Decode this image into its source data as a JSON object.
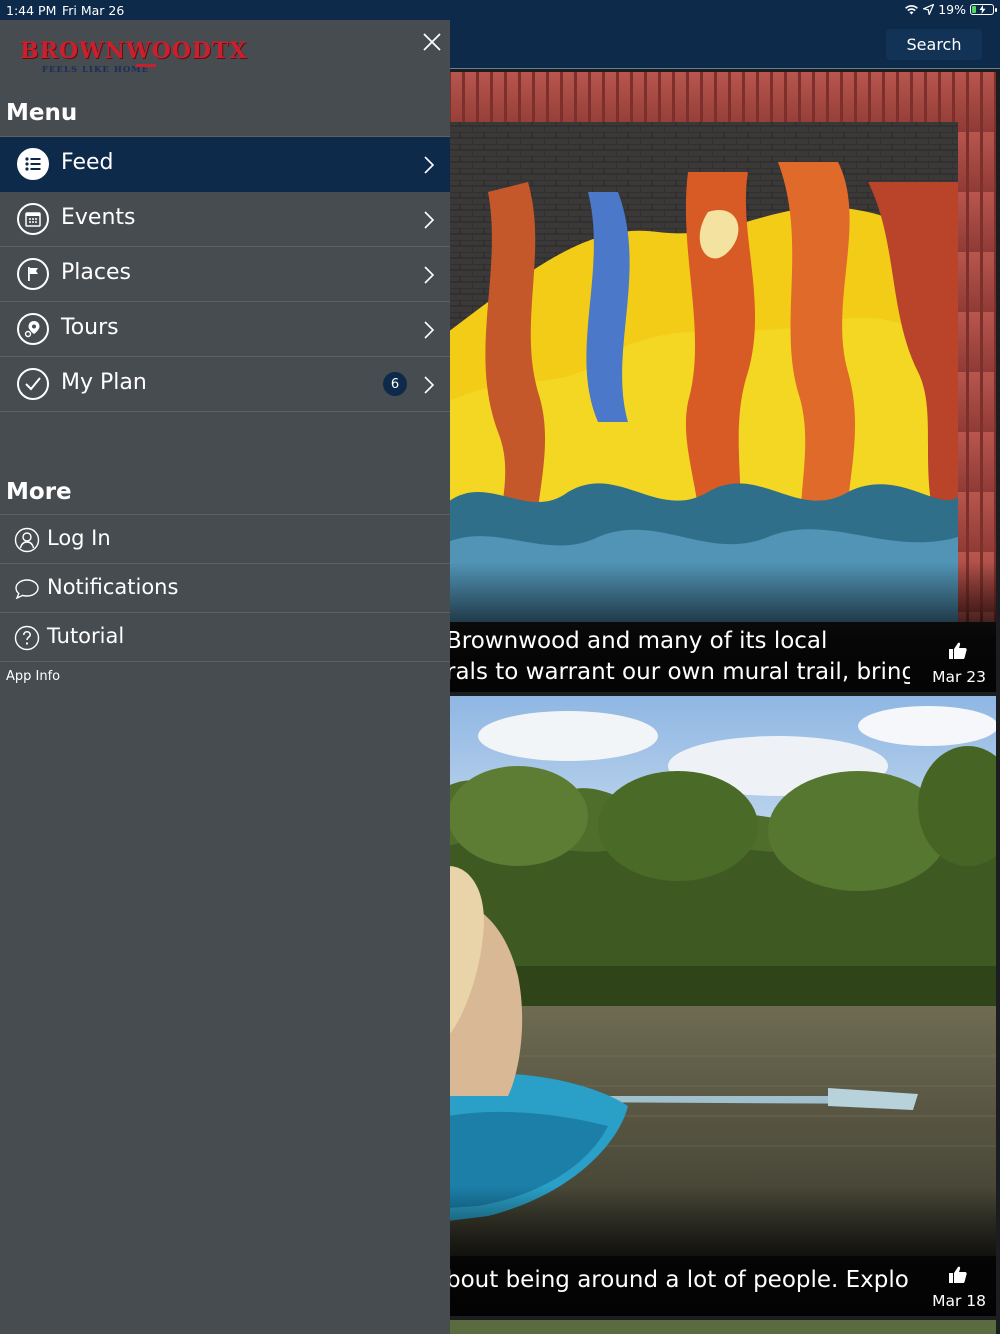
{
  "status_bar": {
    "time": "1:44 PM",
    "date": "Fri Mar 26",
    "battery_text": "19%",
    "battery_level": 0.19
  },
  "header": {
    "search_label": "Search"
  },
  "drawer": {
    "logo": {
      "word": "BROWNWOODTX",
      "tagline": "FEELS LIKE HOME"
    },
    "menu_title": "Menu",
    "menu_items": [
      {
        "label": "Feed",
        "icon": "list-icon",
        "active": true
      },
      {
        "label": "Events",
        "icon": "calendar-icon",
        "active": false
      },
      {
        "label": "Places",
        "icon": "flag-icon",
        "active": false
      },
      {
        "label": "Tours",
        "icon": "map-pin-icon",
        "active": false
      },
      {
        "label": "My Plan",
        "icon": "checkmark-icon",
        "active": false,
        "badge": "6"
      }
    ],
    "more_title": "More",
    "more_items": [
      {
        "label": "Log In",
        "icon": "user-icon"
      },
      {
        "label": "Notifications",
        "icon": "chat-bubble-icon"
      },
      {
        "label": "Tutorial",
        "icon": "help-icon"
      }
    ],
    "app_info": "App Info"
  },
  "feed": {
    "cards": [
      {
        "excerpt_line1": "Brownwood and many of its local",
        "excerpt_line2": "rals to warrant our own mural trail, bring...",
        "date": "Mar 23",
        "image": "mural-photo"
      },
      {
        "excerpt_line1": "bout being around a lot of people. Explore",
        "date": "Mar 18",
        "image": "kayak-photo"
      }
    ]
  },
  "colors": {
    "navy": "#0d2a4a",
    "drawer_bg": "#474c51",
    "logo_red": "#c8202c"
  }
}
